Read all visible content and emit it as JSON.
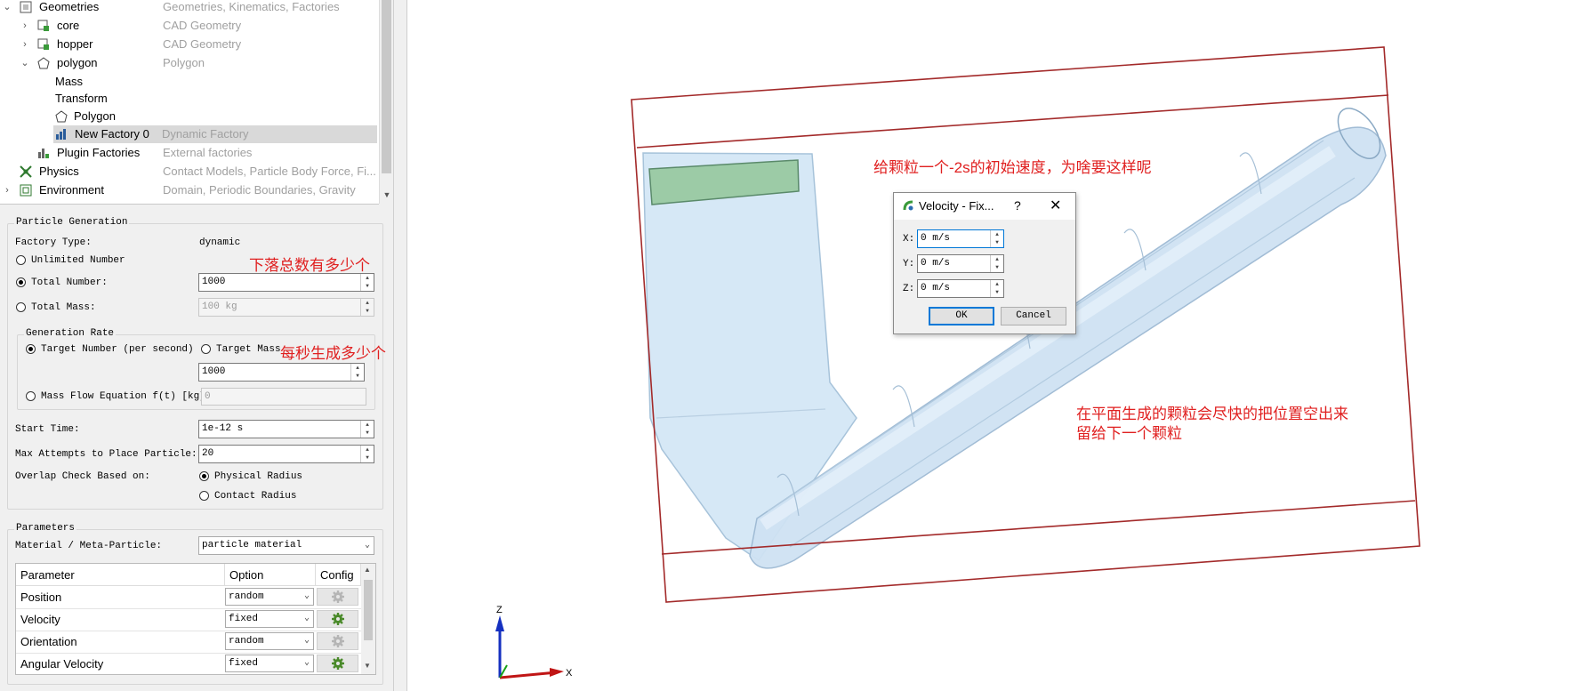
{
  "tree": {
    "rows": [
      {
        "name": "Geometries",
        "desc": "Geometries, Kinematics, Factories"
      },
      {
        "name": "core",
        "desc": "CAD Geometry"
      },
      {
        "name": "hopper",
        "desc": "CAD Geometry"
      },
      {
        "name": "polygon",
        "desc": "Polygon"
      },
      {
        "name": "Mass",
        "desc": ""
      },
      {
        "name": "Transform",
        "desc": ""
      },
      {
        "name": "Polygon",
        "desc": ""
      },
      {
        "name": "New Factory 0",
        "desc": "Dynamic Factory"
      },
      {
        "name": "Plugin Factories",
        "desc": "External factories"
      },
      {
        "name": "Physics",
        "desc": "Contact Models, Particle Body Force, Fi..."
      },
      {
        "name": "Environment",
        "desc": "Domain, Periodic Boundaries, Gravity"
      }
    ]
  },
  "generation": {
    "title": "Particle Generation",
    "factory_type_label": "Factory Type:",
    "factory_type_value": "dynamic",
    "unlimited_label": "Unlimited Number",
    "total_number_label": "Total Number:",
    "total_number_value": "1000",
    "total_mass_label": "Total Mass:",
    "total_mass_value": "100 kg",
    "rate_title": "Generation Rate",
    "target_number_label": "Target Number (per second)",
    "target_mass_label": "Target Mass",
    "rate_value": "1000",
    "mass_flow_label": "Mass Flow Equation f(t) [kg]",
    "mass_flow_value": "0",
    "start_time_label": "Start Time:",
    "start_time_value": "1e-12 s",
    "max_attempts_label": "Max Attempts to Place Particle:",
    "max_attempts_value": "20",
    "overlap_label": "Overlap Check Based on:",
    "physical_radius_label": "Physical Radius",
    "contact_radius_label": "Contact Radius"
  },
  "parameters": {
    "title": "Parameters",
    "material_label": "Material / Meta-Particle:",
    "material_value": "particle material",
    "columns": [
      "Parameter",
      "Option",
      "Config"
    ],
    "rows": [
      {
        "param": "Position",
        "option": "random"
      },
      {
        "param": "Velocity",
        "option": "fixed"
      },
      {
        "param": "Orientation",
        "option": "random"
      },
      {
        "param": "Angular Velocity",
        "option": "fixed"
      }
    ]
  },
  "annotations": {
    "total": "下落总数有多少个",
    "per_second": "每秒生成多少个",
    "velocity": "给颗粒一个-2s的初始速度，为啥要这样呢",
    "plane_line1": "在平面生成的颗粒会尽快的把位置空出来",
    "plane_line2": "留给下一个颗粒"
  },
  "dialog": {
    "title": "Velocity - Fix...",
    "help": "?",
    "x_label": "X:",
    "x_value": "0 m/s",
    "y_label": "Y:",
    "y_value": "0 m/s",
    "z_label": "Z:",
    "z_value": "0 m/s",
    "ok": "OK",
    "cancel": "Cancel"
  },
  "axes": {
    "z": "Z",
    "x": "X"
  },
  "colors": {
    "box": "#a32a2a",
    "geometry": "#c9dff0",
    "annotation": "#e02020",
    "selection": "#d9d9d9"
  }
}
